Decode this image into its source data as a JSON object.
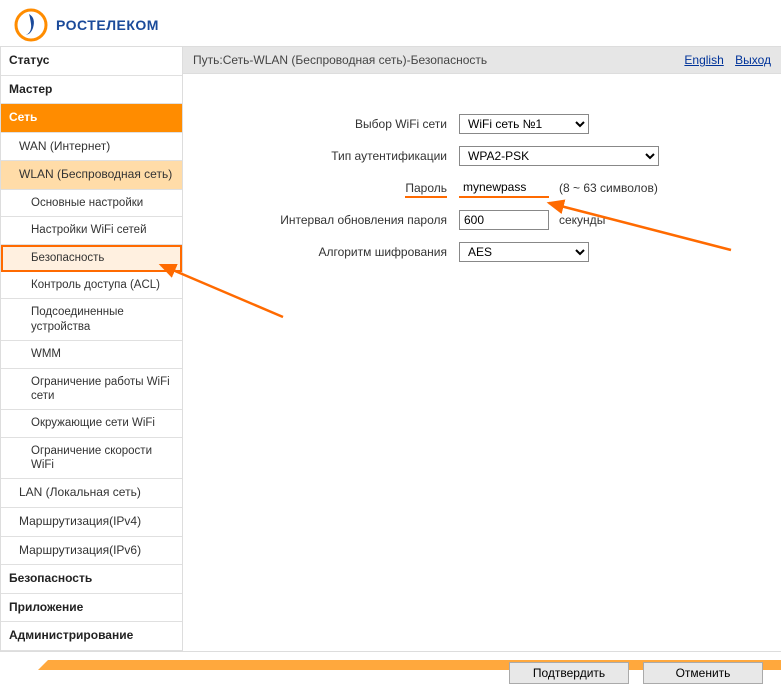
{
  "brand": "РОСТЕЛЕКОМ",
  "nav": {
    "status": "Статус",
    "master": "Мастер",
    "net": "Сеть",
    "wan": "WAN (Интернет)",
    "wlan": "WLAN (Беспроводная сеть)",
    "wlan_sub": {
      "basic": "Основные настройки",
      "wifi_settings": "Настройки WiFi сетей",
      "security": "Безопасность",
      "acl": "Контроль доступа (ACL)",
      "connected": "Подсоединенные устройства",
      "wmm": "WMM",
      "limit_work": "Ограничение работы WiFi сети",
      "surround": "Окружающие сети WiFi",
      "limit_speed": "Ограничение скорости WiFi"
    },
    "lan": "LAN (Локальная сеть)",
    "route4": "Маршрутизация(IPv4)",
    "route6": "Маршрутизация(IPv6)",
    "security": "Безопасность",
    "app": "Приложение",
    "admin": "Администрирование"
  },
  "breadcrumb": "Путь:Сеть-WLAN (Беспроводная сеть)-Безопасность",
  "links": {
    "english": "English",
    "exit": "Выход"
  },
  "form": {
    "wifi_select_lbl": "Выбор WiFi сети",
    "wifi_select_val": "WiFi сеть №1",
    "auth_lbl": "Тип аутентификации",
    "auth_val": "WPA2-PSK",
    "pass_lbl": "Пароль",
    "pass_val": "mynewpass",
    "pass_hint": "(8 ~ 63 символов)",
    "interval_lbl": "Интервал обновления пароля",
    "interval_val": "600",
    "interval_unit": "секунды",
    "enc_lbl": "Алгоритм шифрования",
    "enc_val": "AES"
  },
  "buttons": {
    "apply": "Подтвердить",
    "cancel": "Отменить"
  }
}
